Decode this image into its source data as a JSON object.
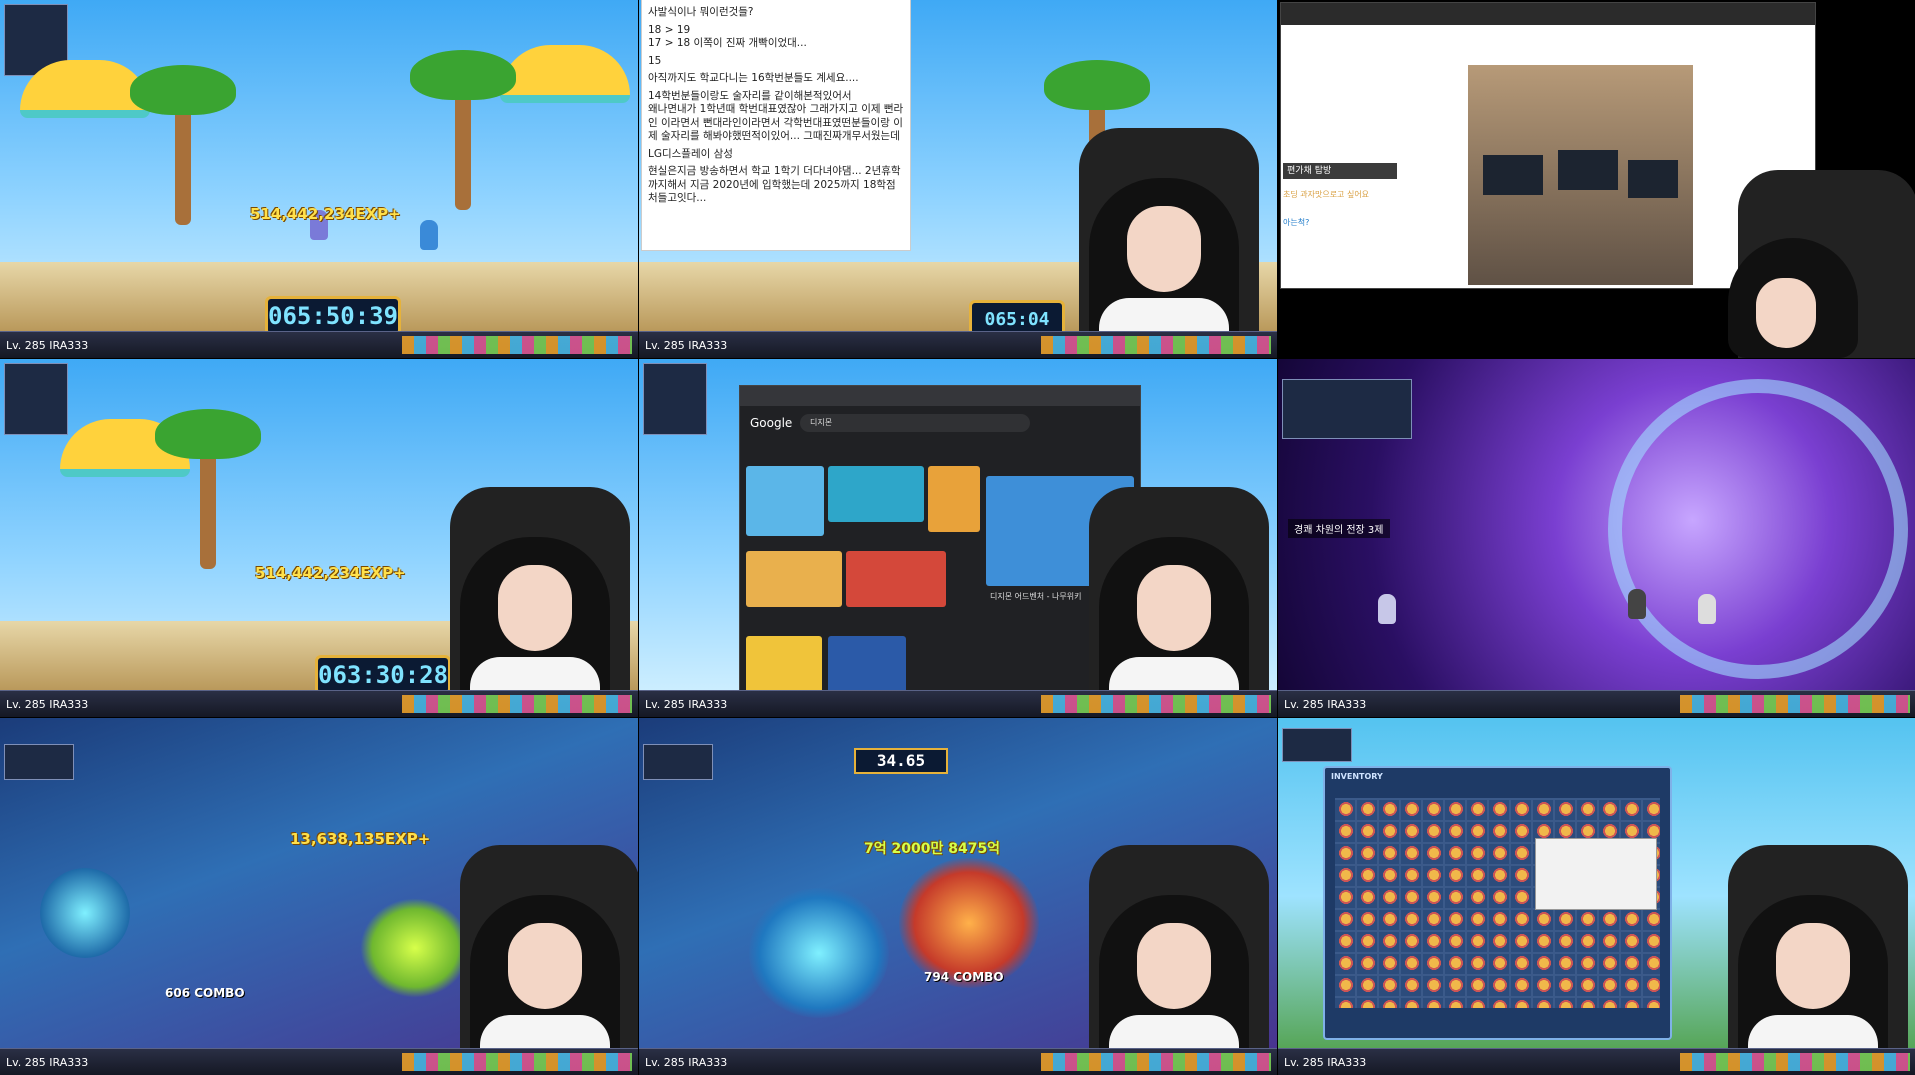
{
  "cells": [
    {
      "id": "tile-1",
      "level": "Lv. 285",
      "name": "IRA333",
      "exp": "514,442,234EXP+",
      "timer": "065:50:39"
    },
    {
      "id": "tile-2",
      "level": "Lv. 285",
      "name": "IRA333",
      "timer": "065:04"
    },
    {
      "id": "tile-3",
      "stream_label": "편가채 탑방",
      "chat_1": "초딩 과자맛으로고 싶어요",
      "chat_2": "아는척?"
    },
    {
      "id": "tile-4",
      "level": "Lv. 285",
      "name": "IRA333",
      "exp": "514,442,234EXP+",
      "timer": "063:30:28"
    },
    {
      "id": "tile-5",
      "level": "Lv. 285",
      "name": "IRA333",
      "browser_brand": "Google",
      "search_query": "디지몬",
      "result_title": "디지몬 어드벤처 - 나무위키"
    },
    {
      "id": "tile-6",
      "level": "Lv. 285",
      "name": "IRA333",
      "map_title": "경쾌 차원의 전장 3제"
    },
    {
      "id": "tile-7",
      "level": "Lv. 285",
      "name": "IRA333",
      "exp": "13,638,135EXP+",
      "combo": "606 COMBO"
    },
    {
      "id": "tile-8",
      "level": "Lv. 285",
      "name": "IRA333",
      "countdown": "34.65",
      "damage": "7억 2000만 8475억",
      "combo": "794 COMBO"
    },
    {
      "id": "tile-9",
      "level": "Lv. 285",
      "name": "IRA333",
      "inventory_title": "INVENTORY"
    }
  ],
  "notepad": {
    "lines": [
      "사발식이나 뭐이런것들?",
      "18 > 19\n17 > 18 이쪽이 진짜 개빡이었대...",
      "15",
      "아직까지도 학교다니는 16학번분들도 계세요....",
      "14학번분들이랑도 술자리를 같이해본적있어서\n왜나면내가 1학년때 학번대표였잖아 그래가지고 이제 뻔라인 이라면서 뻔대라인이라면서 각학번대표였떤분들이랑 이제 술자리를 해봐야했떤적이있어... 그때진짜개무서웠는데",
      "LG디스플레이 삼성",
      "현실은지금 방송하면서 학교 1학기 더다녀야댐... 2년휴학까지해서 지금 2020년에 입학했는데 2025까지 18학점 처들고잇다..."
    ]
  },
  "colors": {
    "exp_yellow": "#ffe04a",
    "timer_border": "#e6b23a",
    "skybar": "#3fa9f5"
  }
}
